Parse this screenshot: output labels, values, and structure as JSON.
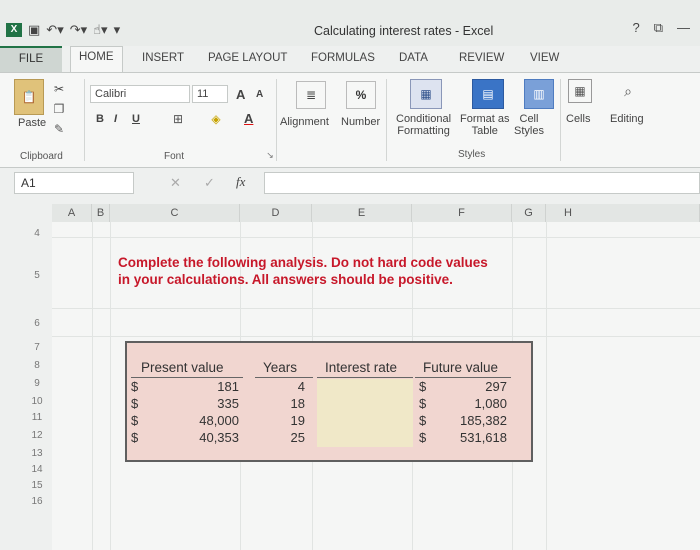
{
  "window": {
    "title": "Calculating interest rates - Excel",
    "controls": [
      "?",
      "⧉",
      "—"
    ]
  },
  "tabs": [
    "FILE",
    "HOME",
    "INSERT",
    "PAGE LAYOUT",
    "FORMULAS",
    "DATA",
    "REVIEW",
    "VIEW"
  ],
  "ribbon": {
    "paste": "Paste",
    "clipboard": "Clipboard",
    "font_name": "Calibri",
    "font_size": "11",
    "font_group": "Font",
    "bold": "B",
    "italic": "I",
    "underline": "U",
    "grow": "A",
    "shrink": "A",
    "font_color": "A",
    "alignment": "Alignment",
    "number": "Number",
    "percent": "%",
    "conditional": "Conditional",
    "formatting": "Formatting",
    "format_as": "Format as",
    "table": "Table",
    "cell": "Cell",
    "cell_styles": "Styles",
    "styles_group": "Styles",
    "cells": "Cells",
    "editing": "Editing"
  },
  "formula_bar": {
    "name_box": "A1",
    "fx": "fx",
    "cancel": "✕",
    "enter": "✓"
  },
  "columns": [
    "A",
    "B",
    "C",
    "D",
    "E",
    "F",
    "G",
    "H"
  ],
  "rows": [
    "4",
    "5",
    "6",
    "7",
    "8",
    "9",
    "10",
    "11",
    "12",
    "13",
    "14",
    "15",
    "16"
  ],
  "instruction": "Complete the following analysis. Do not hard code values in your calculations. All answers should be positive.",
  "table": {
    "headers": [
      "Present value",
      "Years",
      "Interest rate",
      "Future value"
    ],
    "currency": "$",
    "rows": [
      {
        "pv": "181",
        "years": "4",
        "fv": "297"
      },
      {
        "pv": "335",
        "years": "18",
        "fv": "1,080"
      },
      {
        "pv": "48,000",
        "years": "19",
        "fv": "185,382"
      },
      {
        "pv": "40,353",
        "years": "25",
        "fv": "531,618"
      }
    ]
  }
}
